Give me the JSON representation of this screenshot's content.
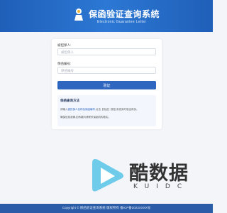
{
  "header": {
    "title": "保函验证查询系统",
    "subtitle": "Electronic Guarantee Letter"
  },
  "form": {
    "applicant_label": "被担保人:",
    "applicant_placeholder": "被担保人",
    "guarantee_label": "保函编号:",
    "guarantee_placeholder": "保函编号",
    "verify_label": "验证"
  },
  "instructions": {
    "title": "保函查询方法",
    "line1_prefix": "请输入",
    "line1_link": "被担保人名称及保函编号",
    "line1_suffix": ",点击【验证】按钮,系统实时验证真伪。",
    "line2": "确保信息准确,如有疑问请联系保函机构核实。"
  },
  "watermark": {
    "text": "酷数据",
    "sub": "KUIDC"
  },
  "footer": {
    "text": "Copyright © 保函验证查询系统 版权所有 备ICP备2023XXXX号"
  },
  "colors": {
    "primary": "#2f66c0",
    "header": "#2c78d4",
    "footer": "#2a5ca8"
  }
}
